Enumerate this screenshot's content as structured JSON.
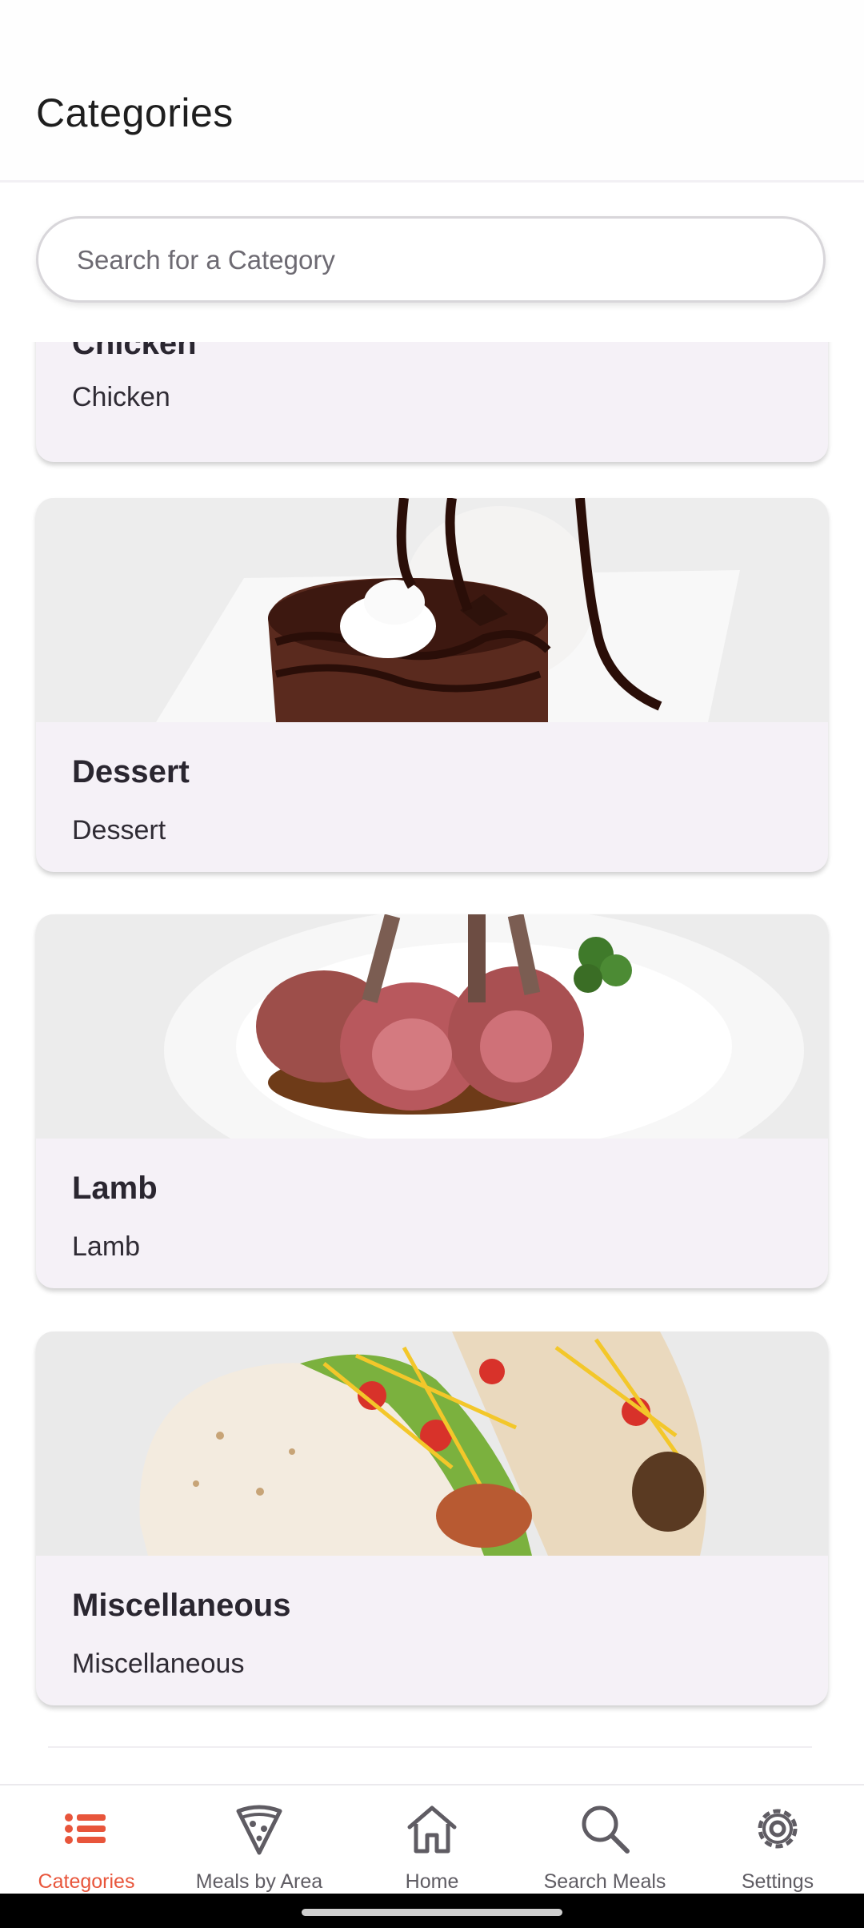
{
  "header": {
    "title": "Categories"
  },
  "search": {
    "placeholder": "Search for a Category",
    "value": ""
  },
  "categories": [
    {
      "title": "Chicken",
      "description": "Chicken",
      "image": "chicken-image"
    },
    {
      "title": "Dessert",
      "description": "Dessert",
      "image": "dessert-image"
    },
    {
      "title": "Lamb",
      "description": "Lamb",
      "image": "lamb-image"
    },
    {
      "title": "Miscellaneous",
      "description": "Miscellaneous",
      "image": "tacos-image"
    }
  ],
  "nav": {
    "items": [
      {
        "label": "Categories",
        "icon": "list-icon",
        "active": true
      },
      {
        "label": "Meals by Area",
        "icon": "pizza-slice-icon",
        "active": false
      },
      {
        "label": "Home",
        "icon": "home-icon",
        "active": false
      },
      {
        "label": "Search Meals",
        "icon": "search-icon",
        "active": false
      },
      {
        "label": "Settings",
        "icon": "gear-icon",
        "active": false
      }
    ]
  },
  "colors": {
    "accent": "#e8553b",
    "card": "#f5f1f7",
    "inactive": "#5f5c63"
  }
}
